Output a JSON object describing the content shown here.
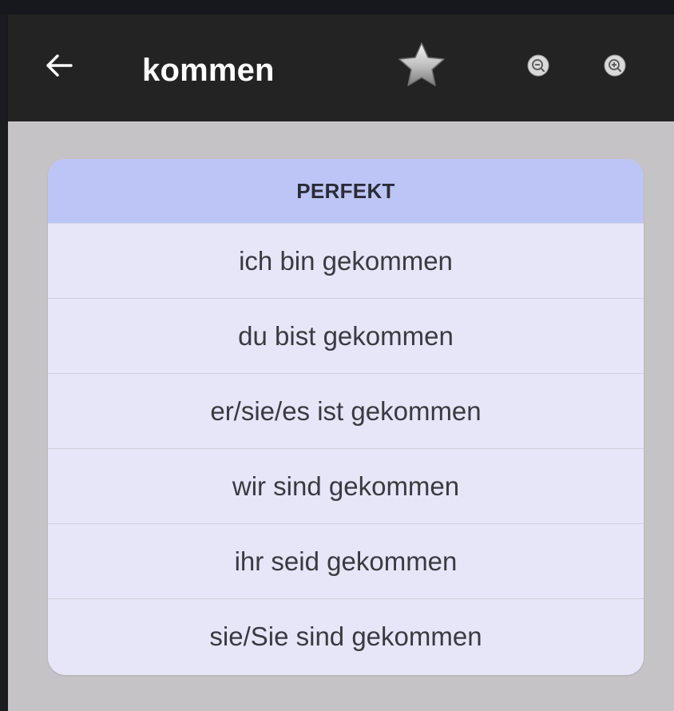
{
  "app_bar": {
    "title": "kommen",
    "back_icon": "arrow-left-icon",
    "favorite_icon": "star-icon",
    "zoom_out_icon": "zoom-out-icon",
    "zoom_in_icon": "zoom-in-icon"
  },
  "conjugation": {
    "tense": "PERFEKT",
    "forms": [
      "ich bin gekommen",
      "du bist gekommen",
      "er/sie/es ist gekommen",
      "wir sind gekommen",
      "ihr seid gekommen",
      "sie/Sie sind gekommen"
    ]
  },
  "colors": {
    "app_bar": "#232323",
    "background": "#c6c3c6",
    "card": "#e7e6f9",
    "card_header": "#bcc5f6"
  }
}
